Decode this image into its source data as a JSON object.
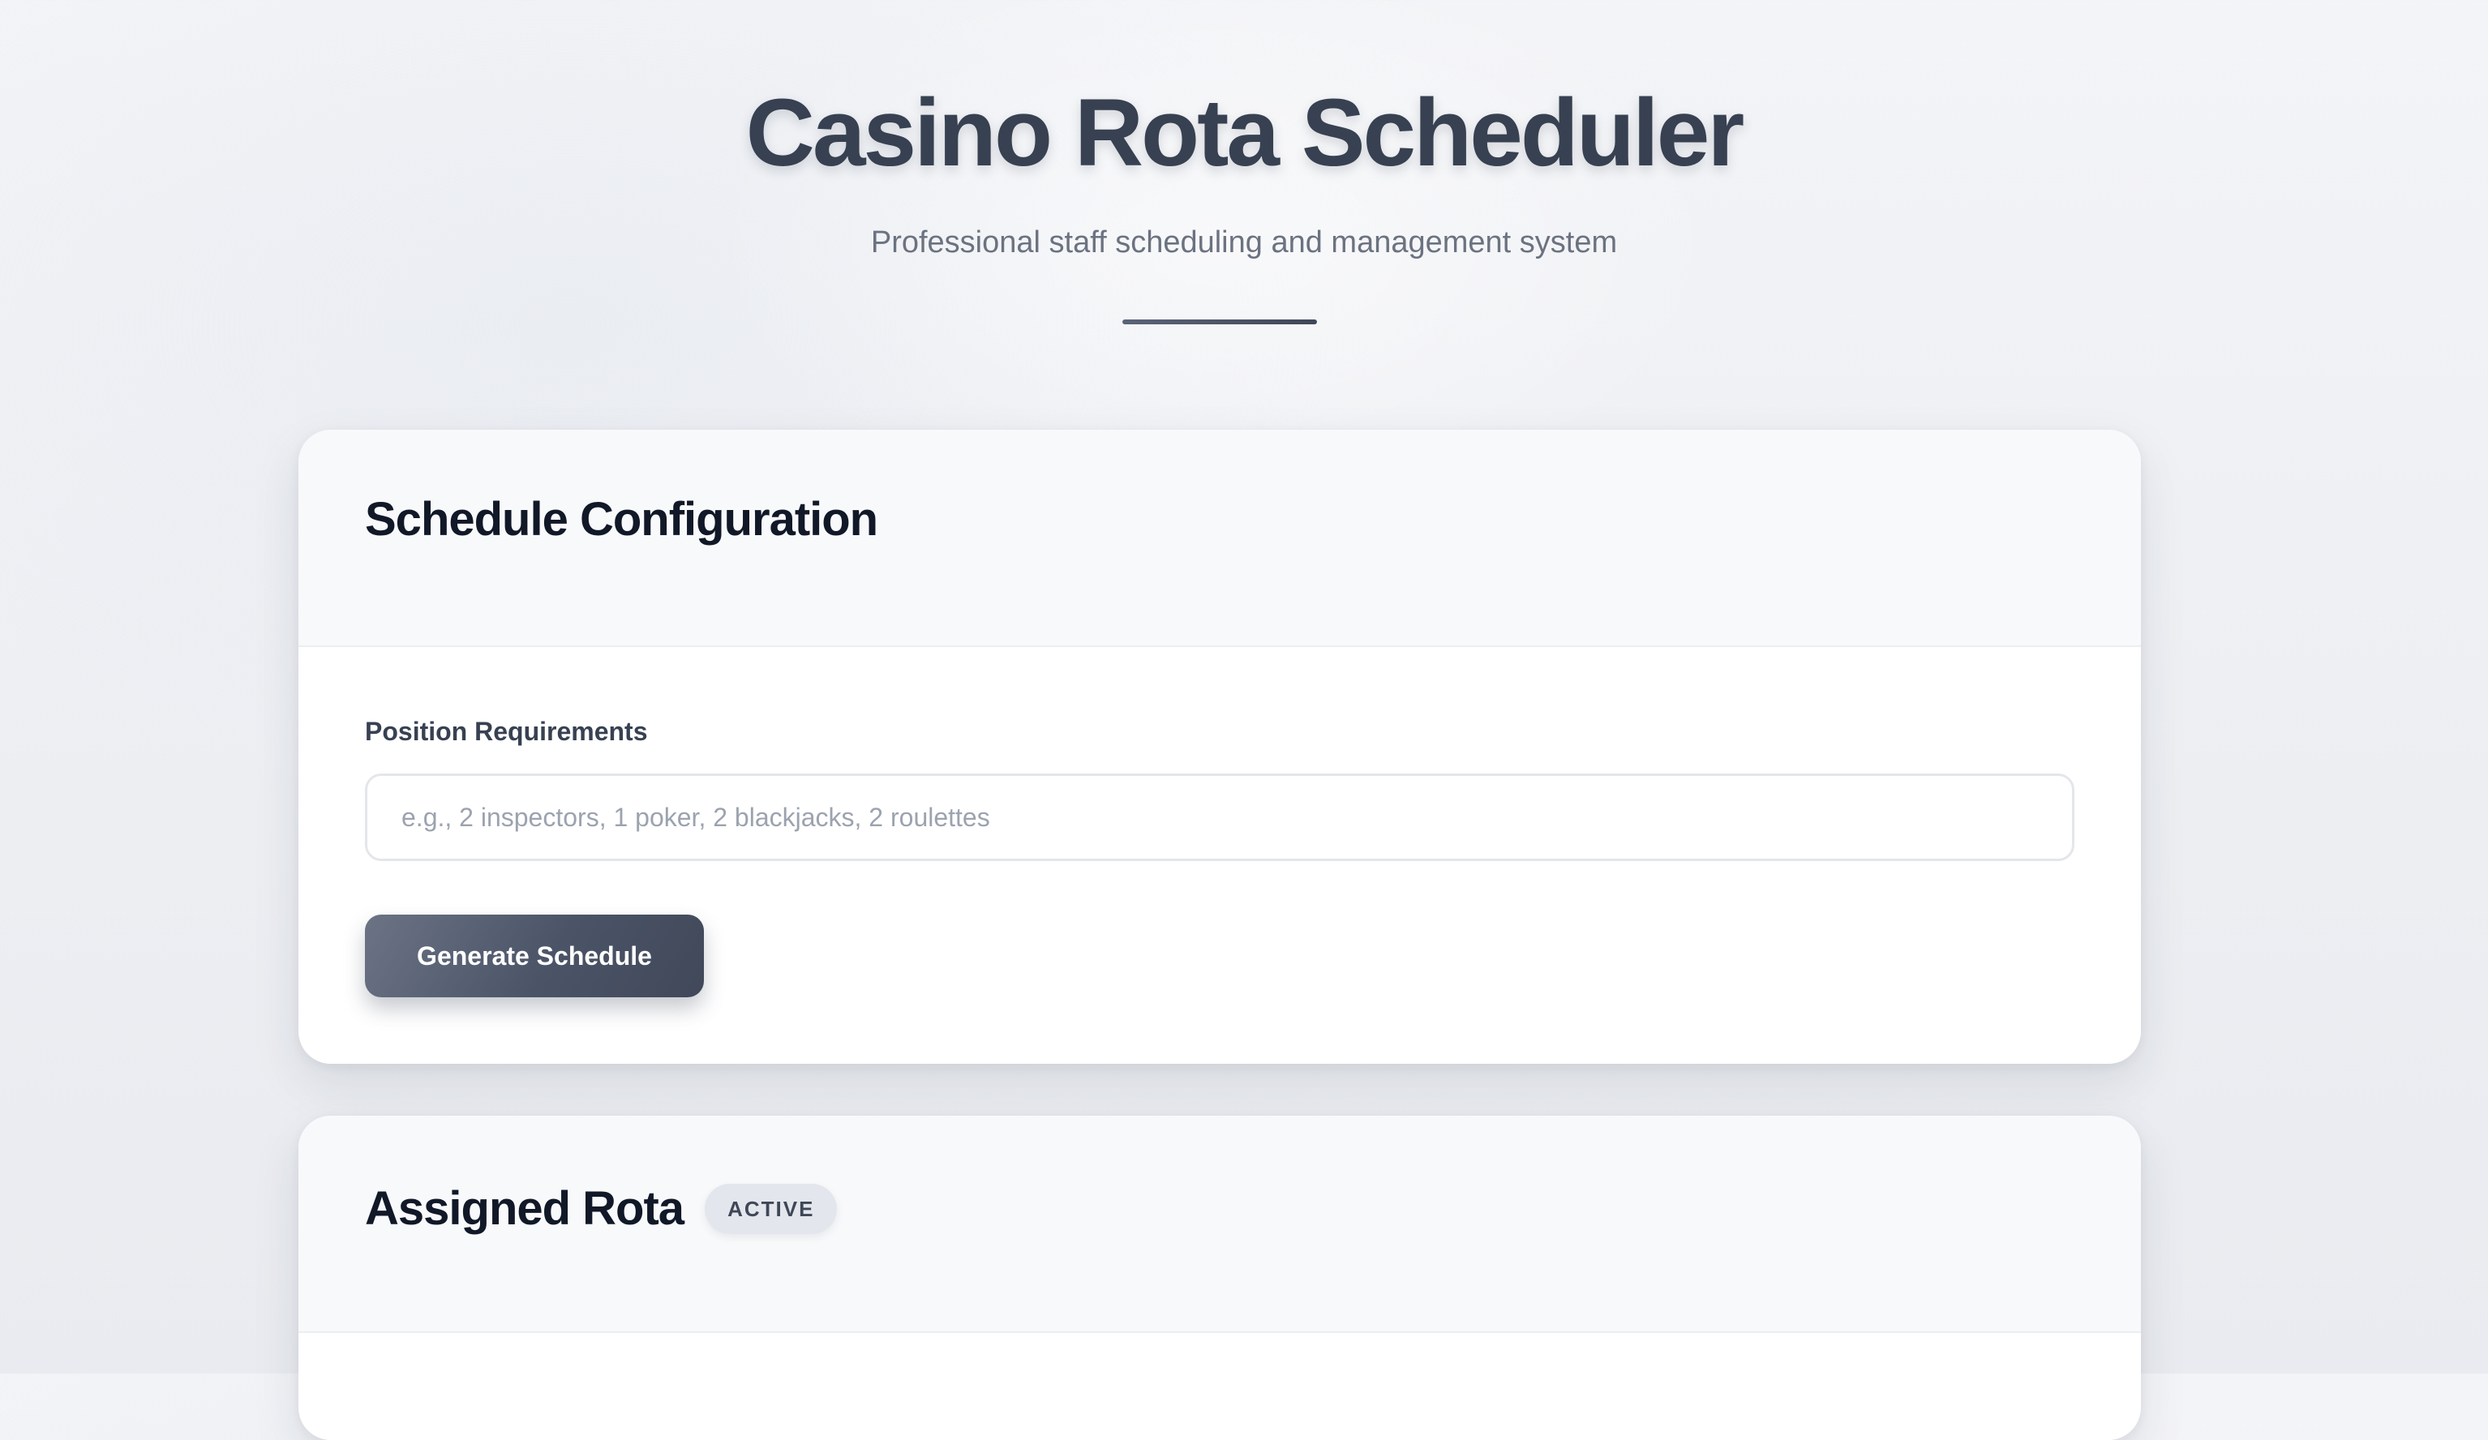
{
  "header": {
    "title": "Casino Rota Scheduler",
    "subtitle": "Professional staff scheduling and management system"
  },
  "config_card": {
    "title": "Schedule Configuration",
    "position_label": "Position Requirements",
    "position_input": {
      "value": "",
      "placeholder": "e.g., 2 inspectors, 1 poker, 2 blackjacks, 2 roulettes"
    },
    "generate_label": "Generate Schedule"
  },
  "rota_card": {
    "title": "Assigned Rota",
    "badge": "ACTIVE"
  },
  "colors": {
    "title_text": "#374151",
    "button_gradient_start": "#6b7385",
    "button_gradient_end": "#404859",
    "badge_bg": "#e3e6ec"
  }
}
